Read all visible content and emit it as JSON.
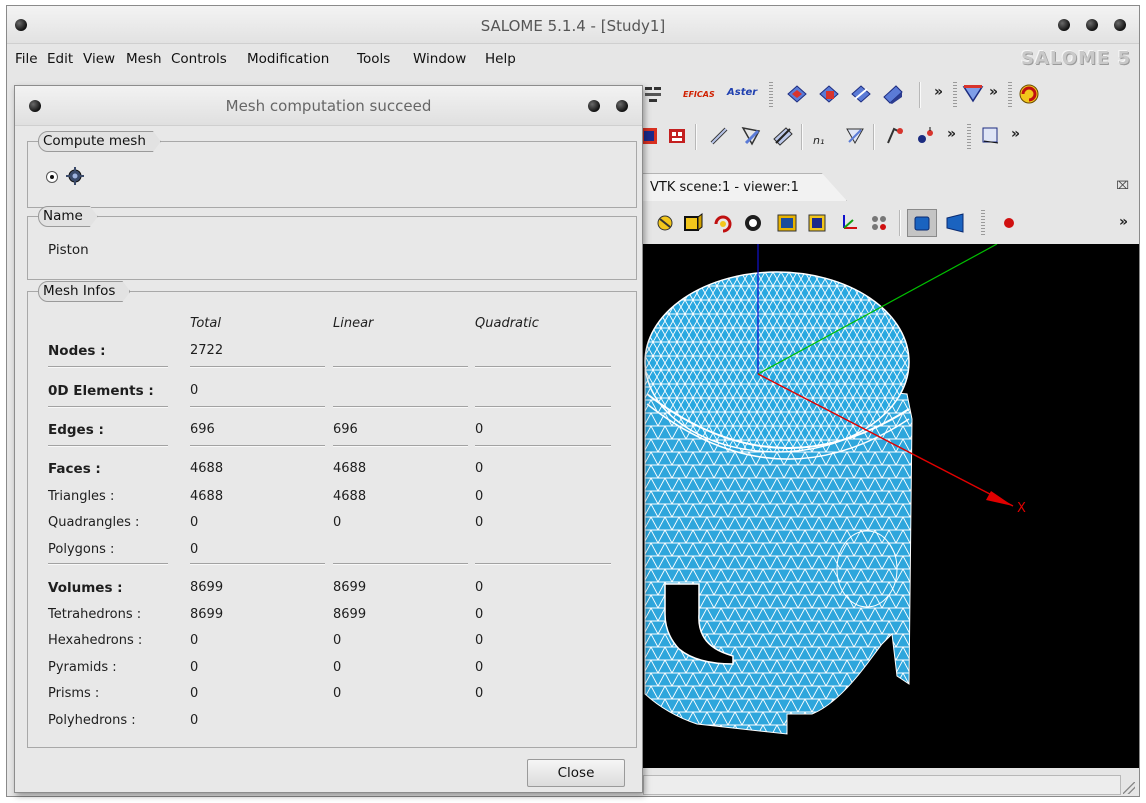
{
  "window": {
    "title": "SALOME 5.1.4 - [Study1]",
    "logo": "SALOME 5"
  },
  "menu": [
    "File",
    "Edit",
    "View",
    "Mesh",
    "Controls",
    "Modification",
    "Tools",
    "Window",
    "Help"
  ],
  "toolbar": {
    "efcas_label": "EFICAS",
    "aster_label": "Aster",
    "more_glyph": "»",
    "node_label": "n₁"
  },
  "viewer": {
    "tab_label": "VTK scene:1 - viewer:1",
    "close_glyph": "⌧",
    "axis_x_label": "X",
    "colors": {
      "mesh_fill": "#29a8e0",
      "mesh_edge": "#ffffff",
      "axis_x": "#e00000",
      "axis_y": "#00c000",
      "axis_z": "#1010cc",
      "background": "#000000"
    }
  },
  "dialog": {
    "title": "Mesh computation succeed",
    "compute_mesh_label": "Compute mesh",
    "name_label": "Name",
    "name_value": "Piston",
    "mesh_infos_label": "Mesh Infos",
    "close_label": "Close",
    "columns": [
      "Total",
      "Linear",
      "Quadratic"
    ],
    "rows": [
      {
        "label": "Nodes :",
        "bold": true,
        "total": "2722",
        "linear": "",
        "quadratic": ""
      },
      {
        "label": "0D Elements :",
        "bold": true,
        "total": "0",
        "linear": "",
        "quadratic": ""
      },
      {
        "label": "Edges :",
        "bold": true,
        "total": "696",
        "linear": "696",
        "quadratic": "0"
      },
      {
        "label": "Faces :",
        "bold": true,
        "total": "4688",
        "linear": "4688",
        "quadratic": "0"
      },
      {
        "label": "Triangles :",
        "bold": false,
        "total": "4688",
        "linear": "4688",
        "quadratic": "0"
      },
      {
        "label": "Quadrangles :",
        "bold": false,
        "total": "0",
        "linear": "0",
        "quadratic": "0"
      },
      {
        "label": "Polygons :",
        "bold": false,
        "total": "0",
        "linear": "",
        "quadratic": ""
      },
      {
        "label": "Volumes :",
        "bold": true,
        "total": "8699",
        "linear": "8699",
        "quadratic": "0"
      },
      {
        "label": "Tetrahedrons :",
        "bold": false,
        "total": "8699",
        "linear": "8699",
        "quadratic": "0"
      },
      {
        "label": "Hexahedrons :",
        "bold": false,
        "total": "0",
        "linear": "0",
        "quadratic": "0"
      },
      {
        "label": "Pyramids :",
        "bold": false,
        "total": "0",
        "linear": "0",
        "quadratic": "0"
      },
      {
        "label": "Prisms :",
        "bold": false,
        "total": "0",
        "linear": "0",
        "quadratic": "0"
      },
      {
        "label": "Polyhedrons :",
        "bold": false,
        "total": "0",
        "linear": "",
        "quadratic": ""
      }
    ]
  }
}
